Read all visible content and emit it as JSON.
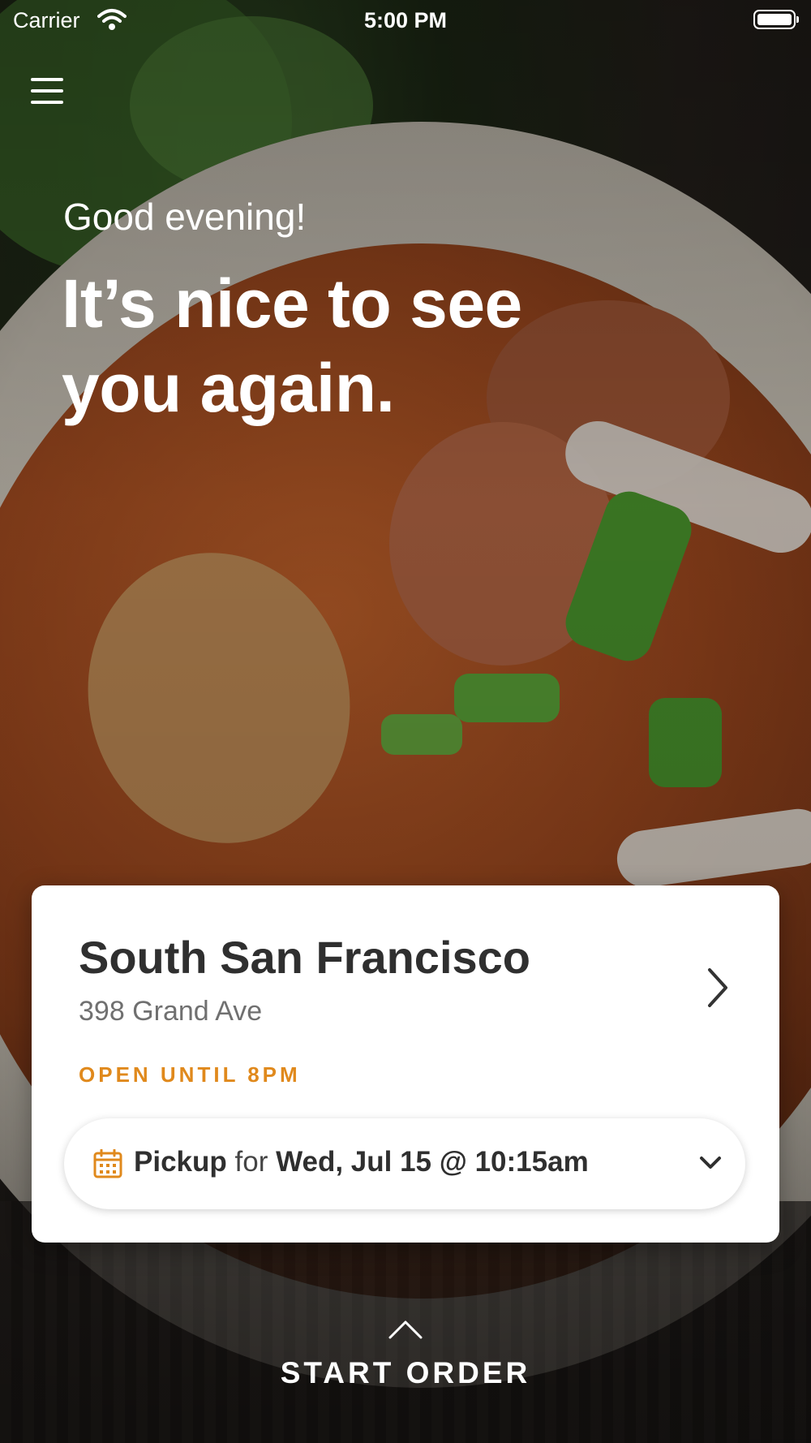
{
  "status_bar": {
    "carrier": "Carrier",
    "time": "5:00 PM",
    "icons": [
      "wifi-icon",
      "battery-icon"
    ]
  },
  "header": {
    "menu_icon": "menu-icon"
  },
  "hero": {
    "greeting": "Good evening!",
    "headline_line1": "It’s nice to see",
    "headline_line2": "you again."
  },
  "location_card": {
    "name": "South San Francisco",
    "address": "398 Grand Ave",
    "hours": "OPEN UNTIL 8PM",
    "hours_color": "#e0891c",
    "pickup": {
      "mode": "Pickup",
      "connector": "for",
      "datetime": "Wed, Jul 15 @ 10:15am"
    }
  },
  "footer": {
    "start_order_label": "START ORDER"
  }
}
